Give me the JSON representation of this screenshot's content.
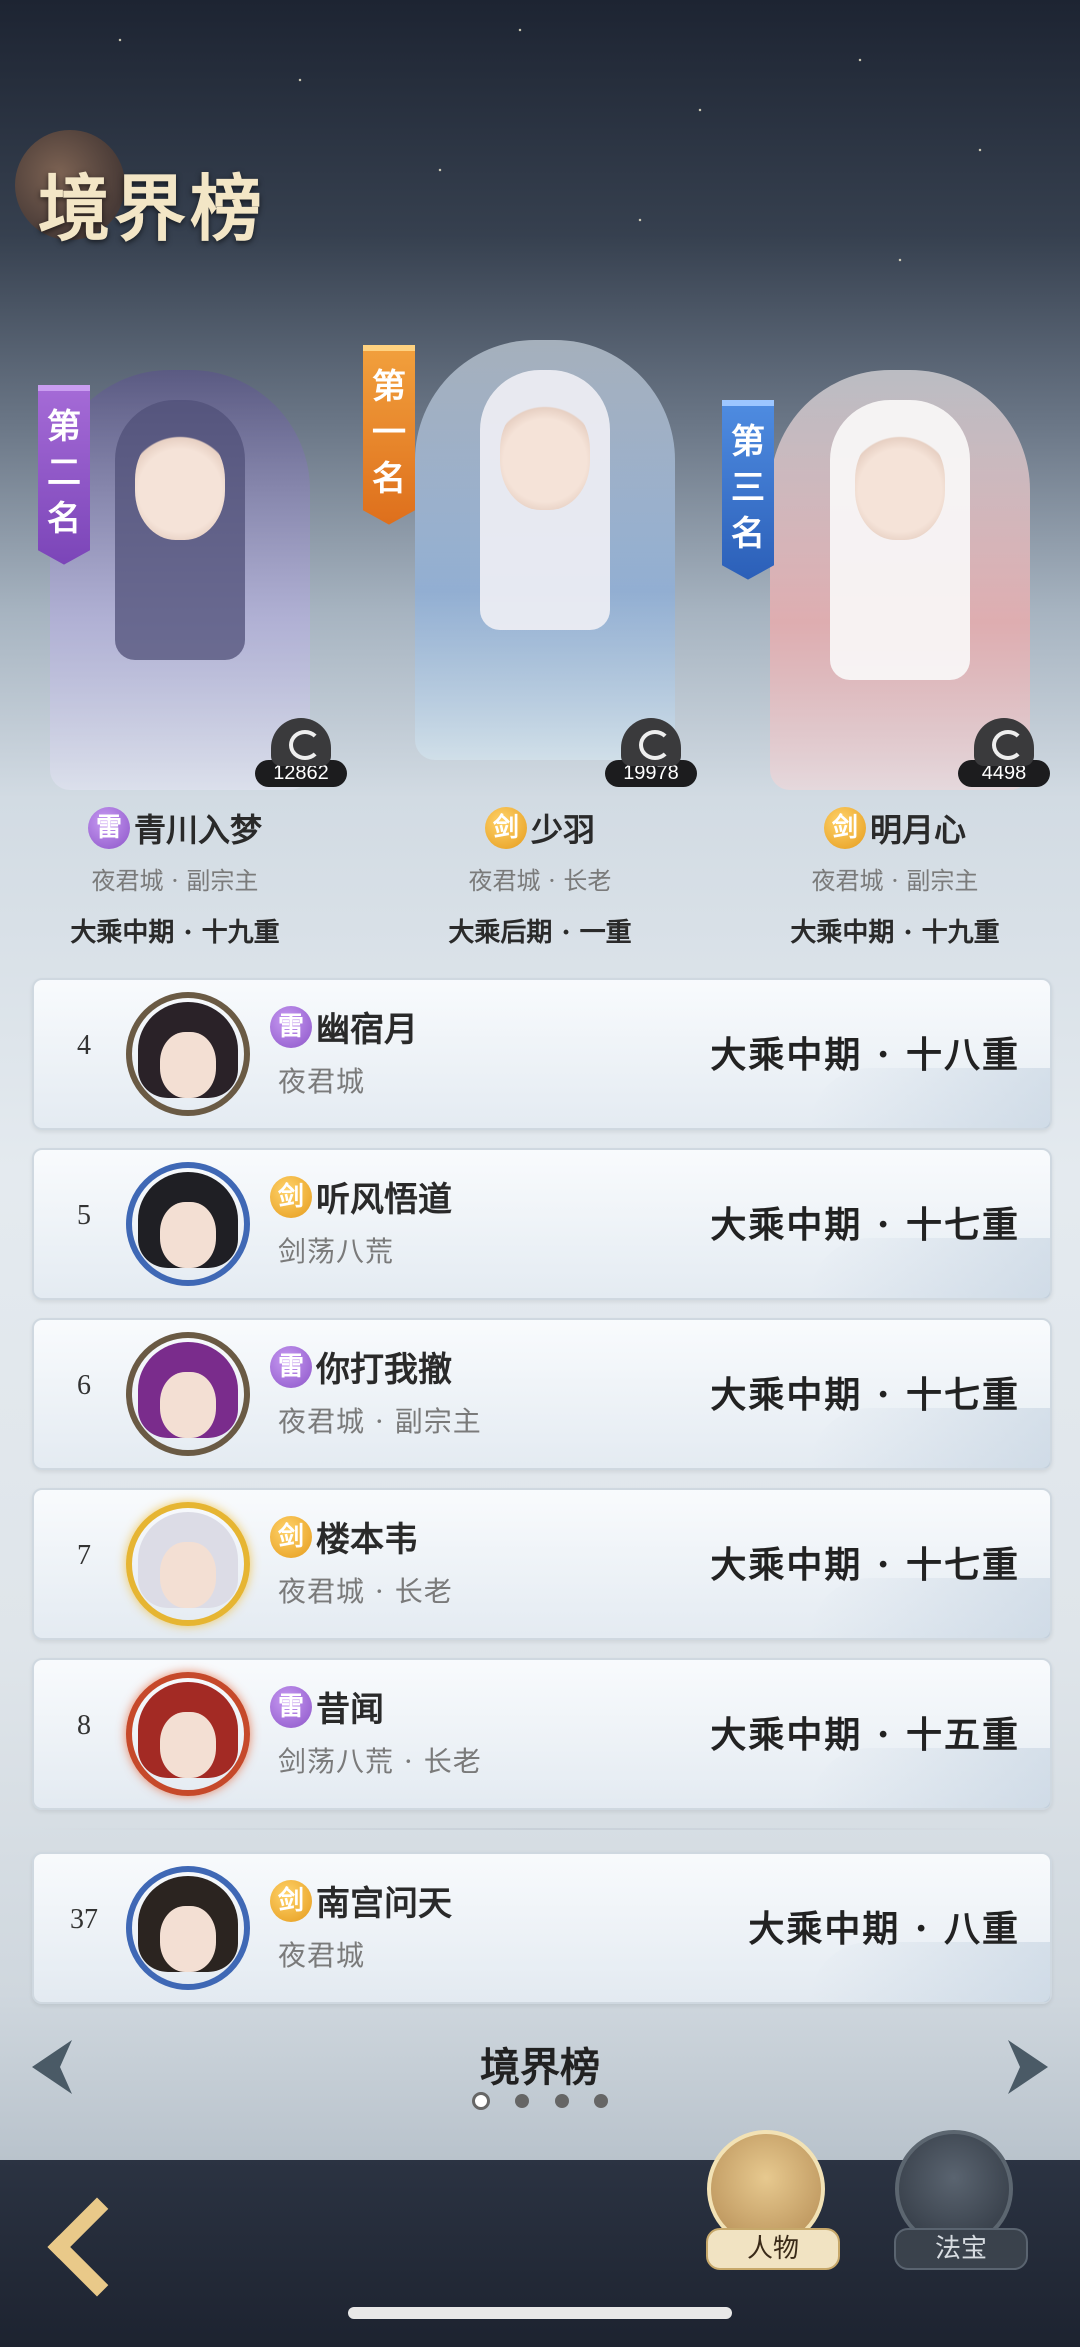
{
  "title": "境界榜",
  "top3": [
    {
      "rank_label": [
        "第",
        "二",
        "名"
      ],
      "name": "青川入梦",
      "element": "雷",
      "sect": "夜君城 · 副宗主",
      "realm": "大乘中期 · 十九重",
      "power": "12862"
    },
    {
      "rank_label": [
        "第",
        "一",
        "名"
      ],
      "name": "少羽",
      "element": "剑",
      "sect": "夜君城 · 长老",
      "realm": "大乘后期 · 一重",
      "power": "19978"
    },
    {
      "rank_label": [
        "第",
        "三",
        "名"
      ],
      "name": "明月心",
      "element": "剑",
      "sect": "夜君城 · 副宗主",
      "realm": "大乘中期 · 十九重",
      "power": "4498"
    }
  ],
  "list": [
    {
      "rank": "4",
      "element": "雷",
      "name": "幽宿月",
      "sect": "夜君城",
      "realm": "大乘中期 · 十八重"
    },
    {
      "rank": "5",
      "element": "剑",
      "name": "听风悟道",
      "sect": "剑荡八荒",
      "realm": "大乘中期 · 十七重"
    },
    {
      "rank": "6",
      "element": "雷",
      "name": "你打我撤",
      "sect": "夜君城 · 副宗主",
      "realm": "大乘中期 · 十七重"
    },
    {
      "rank": "7",
      "element": "剑",
      "name": "楼本韦",
      "sect": "夜君城 · 长老",
      "realm": "大乘中期 · 十七重"
    },
    {
      "rank": "8",
      "element": "雷",
      "name": "昔闻",
      "sect": "剑荡八荒 · 长老",
      "realm": "大乘中期 · 十五重"
    }
  ],
  "self": {
    "rank": "37",
    "element": "剑",
    "name": "南宫问天",
    "sect": "夜君城",
    "realm": "大乘中期 · 八重"
  },
  "board_title": "境界榜",
  "pager": {
    "pages": 4,
    "current": 1
  },
  "nav": {
    "person_label": "人物",
    "treasure_label": "法宝",
    "active": "人物"
  },
  "colors": {
    "thunder": "#9a62d2",
    "sword": "#e8a42a",
    "rank1": "#e8801f",
    "rank2": "#8a55c8",
    "rank3": "#3a74d0"
  }
}
